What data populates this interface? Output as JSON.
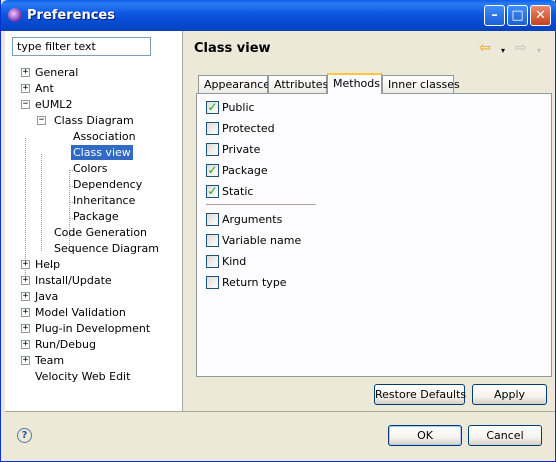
{
  "window": {
    "title": "Preferences",
    "minimize": "–",
    "maximize": "□",
    "close": "✕"
  },
  "filter": {
    "value": "type filter text"
  },
  "tree": {
    "items": [
      {
        "label": "General",
        "expander": "+"
      },
      {
        "label": "Ant",
        "expander": "+"
      },
      {
        "label": "eUML2",
        "expander": "−"
      },
      {
        "label": "Class Diagram",
        "expander": "−"
      },
      {
        "label": "Association"
      },
      {
        "label": "Class view"
      },
      {
        "label": "Colors"
      },
      {
        "label": "Dependency"
      },
      {
        "label": "Inheritance"
      },
      {
        "label": "Package"
      },
      {
        "label": "Code Generation"
      },
      {
        "label": "Sequence Diagram"
      },
      {
        "label": "Help",
        "expander": "+"
      },
      {
        "label": "Install/Update",
        "expander": "+"
      },
      {
        "label": "Java",
        "expander": "+"
      },
      {
        "label": "Model Validation",
        "expander": "+"
      },
      {
        "label": "Plug-in Development",
        "expander": "+"
      },
      {
        "label": "Run/Debug",
        "expander": "+"
      },
      {
        "label": "Team",
        "expander": "+"
      },
      {
        "label": "Velocity Web Edit"
      }
    ]
  },
  "page": {
    "title": "Class view",
    "back_icon": "⇦",
    "dropdown_icon": "▾",
    "forward_icon": "⇨"
  },
  "tabs": [
    {
      "label": "Appearance"
    },
    {
      "label": "Attributes"
    },
    {
      "label": "Methods"
    },
    {
      "label": "Inner classes"
    }
  ],
  "checkboxes": [
    {
      "label": "Public",
      "mark": "✓"
    },
    {
      "label": "Protected",
      "mark": ""
    },
    {
      "label": "Private",
      "mark": ""
    },
    {
      "label": "Package",
      "mark": "✓"
    },
    {
      "label": "Static",
      "mark": "✓"
    },
    {
      "label": "Arguments",
      "mark": ""
    },
    {
      "label": "Variable name",
      "mark": ""
    },
    {
      "label": "Kind",
      "mark": ""
    },
    {
      "label": "Return type",
      "mark": ""
    }
  ],
  "buttons": {
    "restore": "Restore Defaults",
    "apply": "Apply",
    "ok": "OK",
    "cancel": "Cancel",
    "help": "?"
  }
}
